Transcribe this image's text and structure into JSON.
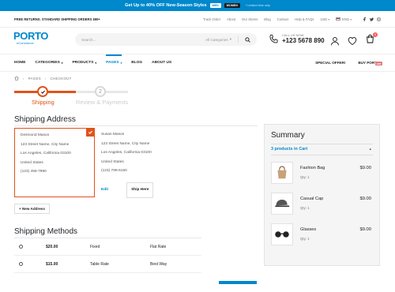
{
  "promo": {
    "lead": "Get Up to",
    "highlight": "40% OFF",
    "rest": "New-Season Styles",
    "btn_men": "MEN",
    "btn_women": "WOMEN",
    "note": "* Limited time only"
  },
  "utility": {
    "left_text": "FREE RETURNS. STANDARD SHIPPING ORDERS $99+",
    "links": [
      "Track Order",
      "About",
      "Our Stores",
      "Blog",
      "Contact",
      "Help & FAQs"
    ],
    "currency": "USD",
    "language": "ENG",
    "social": [
      "facebook-icon",
      "twitter-icon",
      "instagram-icon"
    ]
  },
  "header": {
    "brand": "PORTO",
    "brand_sub": "eCommerce",
    "search_placeholder": "Search...",
    "search_category": "All Categories",
    "phone_label": "CALL US NOW",
    "phone_number": "+123 5678 890",
    "cart_count": "0"
  },
  "nav": {
    "items": [
      {
        "label": "HOME",
        "caret": false
      },
      {
        "label": "CATEGORIES",
        "caret": true
      },
      {
        "label": "PRODUCTS",
        "caret": true
      },
      {
        "label": "PAGES",
        "caret": true
      },
      {
        "label": "BLOG",
        "caret": false
      },
      {
        "label": "ABOUT US",
        "caret": false
      }
    ],
    "special_offer": "SPECIAL OFFER!",
    "buy_porto": "BUY PORTO!",
    "hot_badge": "HOT"
  },
  "breadcrumb": [
    "PAGES",
    "CHECKOUT"
  ],
  "steps": {
    "step1_label": "Shipping",
    "step2_number": "2",
    "step2_label": "Review & Payments"
  },
  "shipping_address": {
    "title": "Shipping Address",
    "addresses": [
      {
        "name": "Desmond Mason",
        "street": "123 Street Name, City Name",
        "city": "Los Angeles, California 03100",
        "country": "United States",
        "phone": "(123) 456-7890"
      },
      {
        "name": "Susan Mason",
        "street": "123 Street Name, City Name",
        "city": "Los Angeles, California 03100",
        "country": "United States",
        "phone": "(123) 789-6150"
      }
    ],
    "edit_label": "Edit",
    "ship_here_label": "Ship Here",
    "new_address_label": "+ New Address"
  },
  "shipping_methods": {
    "title": "Shipping Methods",
    "methods": [
      {
        "price": "$20.00",
        "code": "Fixed",
        "name": "Flat Rate"
      },
      {
        "price": "$15.00",
        "code": "Table Rate",
        "name": "Best Way"
      }
    ]
  },
  "summary": {
    "title": "Summary",
    "products_in_cart": "3 products in Cart",
    "products": [
      {
        "name": "Fashion Bag",
        "qty": "Qty: 1",
        "price": "$9.00",
        "icon": "bag-icon"
      },
      {
        "name": "Casual Cap",
        "qty": "Qty: 1",
        "price": "$9.00",
        "icon": "cap-icon"
      },
      {
        "name": "Glasses",
        "qty": "Qty: 1",
        "price": "$9.00",
        "icon": "glasses-icon"
      }
    ]
  },
  "colors": {
    "brand": "#0088cc",
    "accent": "#e0531a"
  }
}
